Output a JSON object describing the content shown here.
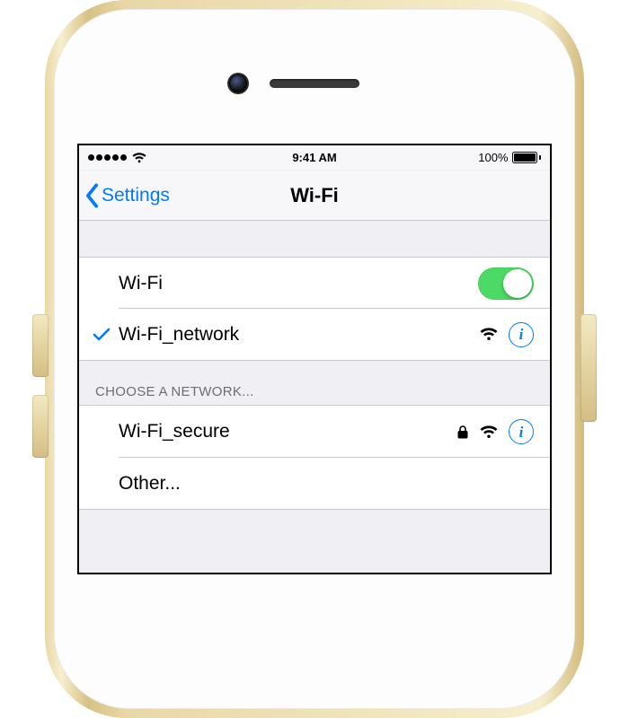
{
  "status": {
    "time": "9:41 AM",
    "battery_text": "100%"
  },
  "nav": {
    "back_label": "Settings",
    "title": "Wi-Fi"
  },
  "wifi_toggle": {
    "label": "Wi-Fi",
    "enabled": true
  },
  "connected_network": {
    "name": "Wi-Fi_network"
  },
  "section": {
    "header": "CHOOSE A NETWORK..."
  },
  "networks": [
    {
      "name": "Wi-Fi_secure",
      "locked": true
    }
  ],
  "other": {
    "label": "Other..."
  },
  "colors": {
    "tint": "#007aff",
    "toggle_on": "#4cd964",
    "group_bg": "#efeff4",
    "separator": "#c8c7cc"
  }
}
